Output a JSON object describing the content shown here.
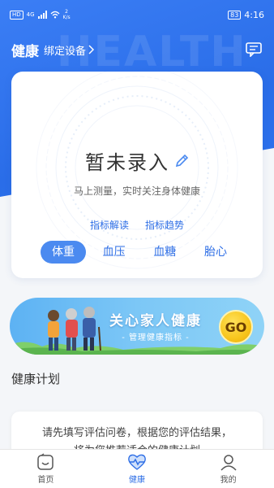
{
  "status_bar": {
    "sim_label": "HD",
    "network": "4G",
    "net_speed": "2",
    "net_unit": "K/s",
    "battery": "83",
    "time": "4:16"
  },
  "header": {
    "title": "健康",
    "bind_device": "绑定设备",
    "watermark": "HEALTH",
    "message_icon": "message-icon"
  },
  "card": {
    "status": "暂未录入",
    "hint": "马上测量，实时关注身体健康",
    "links": [
      "指标解读",
      "指标趋势"
    ],
    "tabs": [
      "体重",
      "血压",
      "血糖",
      "胎心"
    ],
    "active_tab": "体重"
  },
  "banner": {
    "title": "关心家人健康",
    "subtitle": "- 管理健康指标 -",
    "go_label": "GO"
  },
  "plan": {
    "section_title": "健康计划",
    "text_line1": "请先填写评估问卷，根据您的评估结果，",
    "text_line2": "将为您推荐适合的健康计划"
  },
  "nav": {
    "items": [
      {
        "label": "首页",
        "icon": "home-face-icon"
      },
      {
        "label": "健康",
        "icon": "heartbeat-icon"
      },
      {
        "label": "我的",
        "icon": "person-icon"
      }
    ],
    "active": "健康"
  },
  "colors": {
    "primary": "#2f6fe6",
    "tab_active": "#4b8af0",
    "go_yellow": "#f7c51c"
  }
}
